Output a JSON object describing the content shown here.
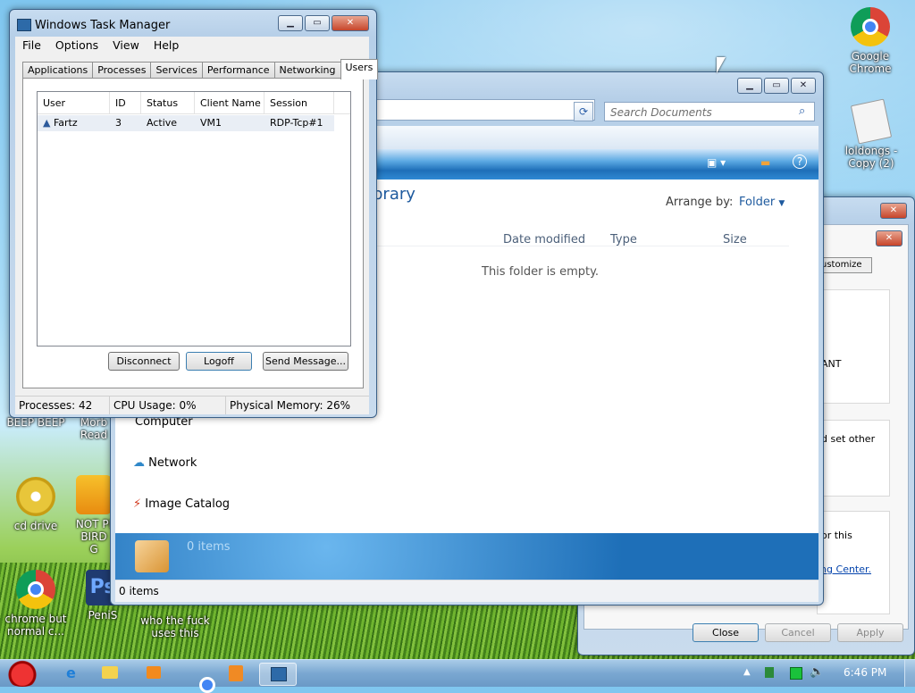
{
  "desktop": {
    "icons": [
      {
        "name": "google-chrome",
        "label": "Google Chrome"
      },
      {
        "name": "loldongs",
        "label": "loldongs - Copy (2)"
      },
      {
        "name": "beep-beep",
        "label": "BEEP BEEP"
      },
      {
        "name": "morb",
        "label": "Morb Read"
      },
      {
        "name": "cd-drive",
        "label": "cd drive"
      },
      {
        "name": "not-pi-bird",
        "label": "NOT PI BIRD G"
      },
      {
        "name": "chrome-normal",
        "label": "chrome but normal c..."
      },
      {
        "name": "penis",
        "label": "PeniS"
      },
      {
        "name": "who-uses-this",
        "label": "who the fuck uses this"
      }
    ]
  },
  "task_manager": {
    "title": "Windows Task Manager",
    "menu": [
      "File",
      "Options",
      "View",
      "Help"
    ],
    "tabs": [
      "Applications",
      "Processes",
      "Services",
      "Performance",
      "Networking",
      "Users"
    ],
    "active_tab": "Users",
    "columns": [
      "User",
      "ID",
      "Status",
      "Client Name",
      "Session"
    ],
    "rows": [
      {
        "user": "Fartz",
        "id": "3",
        "status": "Active",
        "client": "VM1",
        "session": "RDP-Tcp#1"
      }
    ],
    "buttons": {
      "disconnect": "Disconnect",
      "logoff": "Logoff",
      "send_message": "Send Message..."
    },
    "status": {
      "processes": "Processes: 42",
      "cpu": "CPU Usage: 0%",
      "memory": "Physical Memory: 26%"
    }
  },
  "explorer": {
    "search_placeholder": "Search Documents",
    "library_title": "brary",
    "arrange_label": "Arrange by:",
    "arrange_value": "Folder",
    "columns": [
      "Date modified",
      "Type",
      "Size"
    ],
    "empty_text": "This folder is empty.",
    "nav_items": [
      "Computer",
      "Network",
      "Image Catalog"
    ],
    "detail_text": "0 items",
    "status_text": "0 items"
  },
  "control_panel": {
    "customize_label": "ustomize",
    "text_fragments": [
      "ANT",
      "d set other",
      "or this",
      "ing Center."
    ],
    "buttons": {
      "close": "Close",
      "cancel": "Cancel",
      "apply": "Apply"
    }
  },
  "taskbar": {
    "clock": "6:46 PM"
  }
}
